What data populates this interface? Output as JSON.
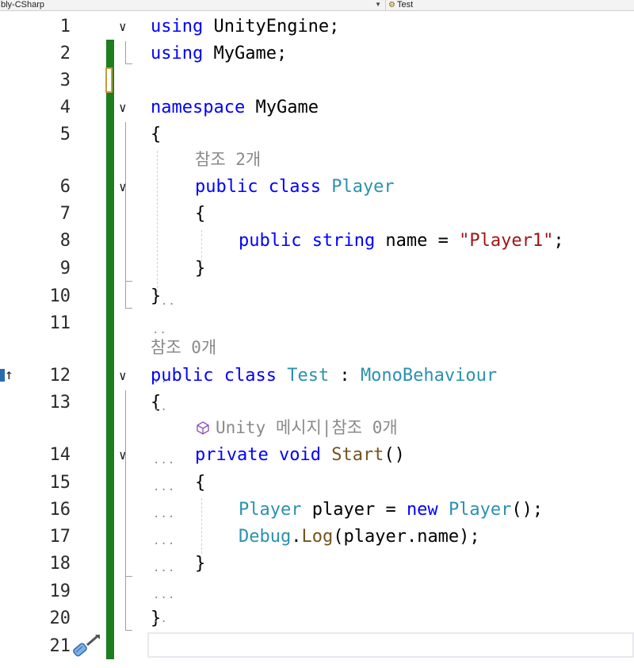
{
  "toolbar": {
    "project_dropdown": "bly-CSharp",
    "member_dropdown": "Test"
  },
  "line_numbers": [
    "1",
    "2",
    "3",
    "4",
    "5",
    "6",
    "7",
    "8",
    "9",
    "10",
    "11",
    "12",
    "13",
    "14",
    "15",
    "16",
    "17",
    "18",
    "19",
    "20",
    "21"
  ],
  "code": {
    "l1": {
      "kw": "using",
      "rest": " UnityEngine;"
    },
    "l2": {
      "kw": "using",
      "rest": " MyGame;"
    },
    "l4": {
      "kw": "namespace",
      "rest": " MyGame"
    },
    "l5": "{",
    "lens1": "참조 2개",
    "l6": {
      "kw": "public class",
      "ty": "Player"
    },
    "l7": "{",
    "l8": {
      "kw": "public string",
      "rest1": " name = ",
      "str": "\"Player1\"",
      "rest2": ";"
    },
    "l9": "}",
    "l10": "}",
    "lens2": "참조 0개",
    "l12": {
      "kw": "public class",
      "ty": "Test",
      "rest": " : ",
      "ty2": "MonoBehaviour"
    },
    "l13": "{",
    "lens3": "Unity 메시지|참조 0개",
    "l14": {
      "kw": "private void",
      "mt": "Start",
      "rest": "()"
    },
    "l15": "{",
    "l16": {
      "ty": "Player",
      "rest1": " player = ",
      "kw": "new",
      "ty2": "Player",
      "rest2": "();"
    },
    "l17": {
      "ty": "Debug",
      "rest1": ".",
      "mt": "Log",
      "rest2": "(player.name);"
    },
    "l18": "}",
    "l20": "}"
  },
  "colors": {
    "keyword": "#0000ff",
    "type": "#2b91af",
    "string": "#a31515",
    "method": "#74531f",
    "change_bar": "#1e7d1e"
  }
}
